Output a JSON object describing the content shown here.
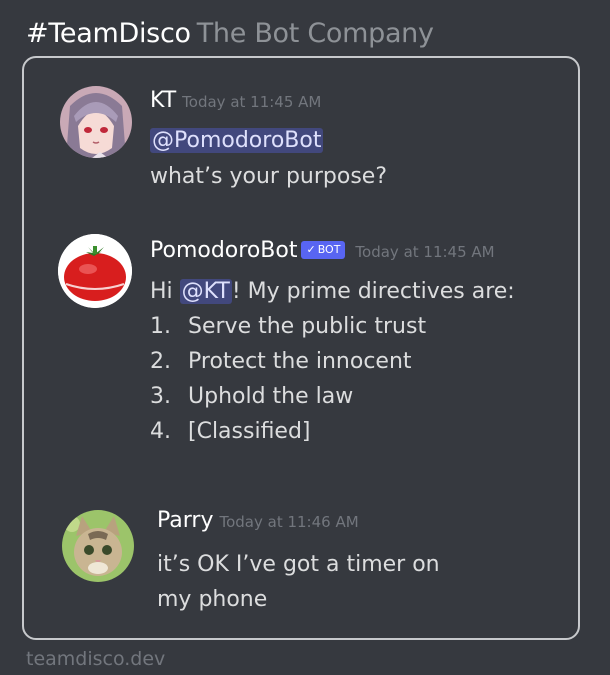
{
  "header": {
    "team": "#TeamDisco",
    "tagline": "The Bot Company"
  },
  "messages": [
    {
      "author": "KT",
      "timestamp": "Today at 11:45 AM",
      "mention": "@PomodoroBot",
      "text": "what’s your purpose?",
      "avatar_icon": "anime-character-avatar"
    },
    {
      "author": "PomodoroBot",
      "bot_badge": "BOT",
      "bot_badge_check": "✓",
      "timestamp": "Today at 11:45 AM",
      "greeting_prefix": "Hi ",
      "mention": "@KT",
      "greeting_suffix": "!  My prime directives are:",
      "list": [
        {
          "num": "1.",
          "text": "Serve the public trust"
        },
        {
          "num": "2.",
          "text": "Protect the innocent"
        },
        {
          "num": "3.",
          "text": "Uphold the law"
        },
        {
          "num": "4.",
          "text": "[Classified]"
        }
      ],
      "avatar_icon": "tomato-timer-avatar"
    },
    {
      "author": "Parry",
      "timestamp": "Today at 11:46 AM",
      "lines": [
        "it’s OK I’ve got a timer on",
        "my phone"
      ],
      "avatar_icon": "kitten-avatar"
    }
  ],
  "footer": "teamdisco.dev",
  "colors": {
    "background": "#36393f",
    "mention_bg": "#5865f2",
    "bot_badge": "#5865f2",
    "timestamp": "#72767d",
    "frame_border": "#c7c9cc"
  }
}
